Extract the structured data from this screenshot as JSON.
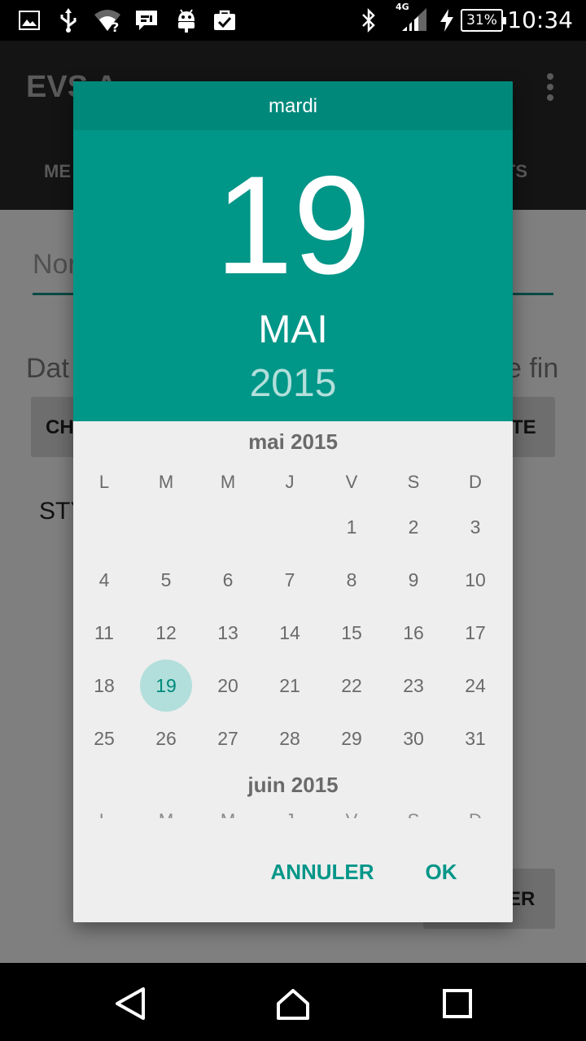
{
  "status_bar": {
    "network": "4G",
    "battery": "31%",
    "time": "10:34"
  },
  "app": {
    "title": "EVS A",
    "tab_left": "ME",
    "tab_right": "CTS",
    "name_hint": "Nor",
    "date_left": "Dat",
    "date_right": "e fin",
    "button_left": "CH",
    "button_right": "TE",
    "style_label": "STY",
    "button_bottom": "ER"
  },
  "dialog": {
    "day_of_week": "mardi",
    "day": "19",
    "month": "MAI",
    "year": "2015",
    "calendar": {
      "month_title": "mai 2015",
      "weekdays": [
        "L",
        "M",
        "M",
        "J",
        "V",
        "S",
        "D"
      ],
      "weeks": [
        [
          "",
          "",
          "",
          "",
          "1",
          "2",
          "3"
        ],
        [
          "4",
          "5",
          "6",
          "7",
          "8",
          "9",
          "10"
        ],
        [
          "11",
          "12",
          "13",
          "14",
          "15",
          "16",
          "17"
        ],
        [
          "18",
          "19",
          "20",
          "21",
          "22",
          "23",
          "24"
        ],
        [
          "25",
          "26",
          "27",
          "28",
          "29",
          "30",
          "31"
        ]
      ],
      "selected_day": "19",
      "next_month_title": "juin 2015"
    },
    "cancel_label": "ANNULER",
    "ok_label": "OK"
  },
  "colors": {
    "accent": "#009688",
    "accent_dark": "#00897b",
    "selected_bg": "#b2dfdb"
  }
}
